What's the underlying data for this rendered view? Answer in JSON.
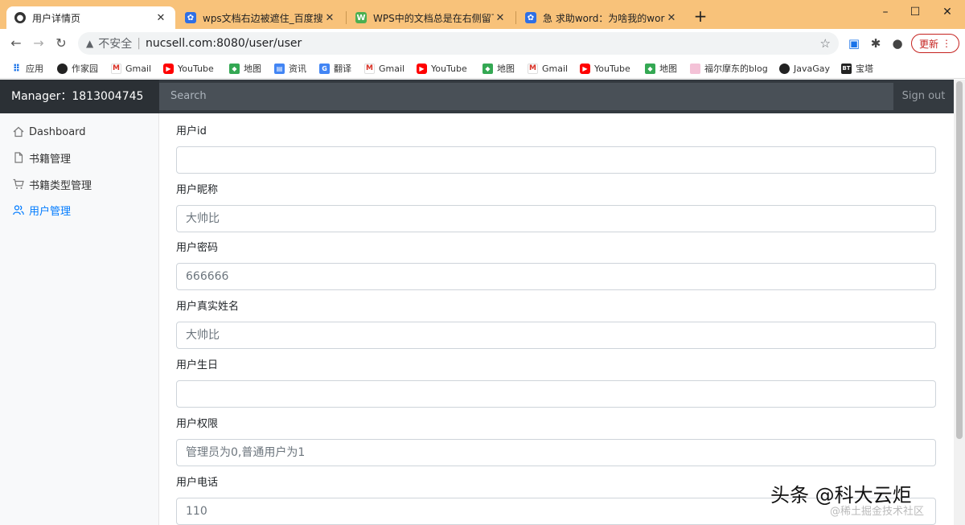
{
  "browser": {
    "tabs": [
      {
        "title": "用户详情页",
        "active": true
      },
      {
        "title": "wps文档右边被遮住_百度搜索",
        "active": false
      },
      {
        "title": "WPS中的文档总是在右侧留下空",
        "active": false
      },
      {
        "title": "急 求助word：为啥我的word打",
        "active": false
      }
    ],
    "new_tab": "+",
    "window_controls": {
      "minimize": "–",
      "maximize": "☐",
      "close": "✕"
    },
    "address": {
      "security_label": "不安全",
      "url": "nucsell.com:8080/user/user"
    },
    "update_label": "更新",
    "bookmarks": [
      {
        "label": "应用",
        "icon": "apps-icon"
      },
      {
        "label": "作家园",
        "icon": "circle-icon"
      },
      {
        "label": "Gmail",
        "icon": "gmail-icon"
      },
      {
        "label": "YouTube",
        "icon": "youtube-icon"
      },
      {
        "label": "地图",
        "icon": "maps-icon"
      },
      {
        "label": "资讯",
        "icon": "news-icon"
      },
      {
        "label": "翻译",
        "icon": "translate-icon"
      },
      {
        "label": "Gmail",
        "icon": "gmail-icon"
      },
      {
        "label": "YouTube",
        "icon": "youtube-icon"
      },
      {
        "label": "地图",
        "icon": "maps-icon"
      },
      {
        "label": "Gmail",
        "icon": "gmail-icon"
      },
      {
        "label": "YouTube",
        "icon": "youtube-icon"
      },
      {
        "label": "地图",
        "icon": "maps-icon"
      },
      {
        "label": "福尔摩东的blog",
        "icon": "blog-icon"
      },
      {
        "label": "JavaGay",
        "icon": "circle-icon"
      },
      {
        "label": "宝塔",
        "icon": "bt-icon"
      }
    ]
  },
  "app": {
    "manager_label": "Manager：1813004745",
    "search_placeholder": "Search",
    "signout_label": "Sign out"
  },
  "sidebar": {
    "items": [
      {
        "label": "Dashboard",
        "icon": "home-icon",
        "active": false
      },
      {
        "label": "书籍管理",
        "icon": "file-icon",
        "active": false
      },
      {
        "label": "书籍类型管理",
        "icon": "cart-icon",
        "active": false
      },
      {
        "label": "用户管理",
        "icon": "users-icon",
        "active": true
      }
    ]
  },
  "form": {
    "fields": [
      {
        "label": "用户id",
        "value": ""
      },
      {
        "label": "用户昵称",
        "value": "大帅比"
      },
      {
        "label": "用户密码",
        "value": "666666"
      },
      {
        "label": "用户真实姓名",
        "value": "大帅比"
      },
      {
        "label": "用户生日",
        "value": ""
      },
      {
        "label": "用户权限",
        "value": "管理员为0,普通用户为1"
      },
      {
        "label": "用户电话",
        "value": "110"
      }
    ]
  },
  "watermark": {
    "main": "头条 @科大云炬",
    "sub": "@稀土掘金技术社区"
  },
  "colors": {
    "tabstrip": "#f8c27a",
    "navbar": "#343a40",
    "active_link": "#007bff",
    "update_button": "#c5221f"
  }
}
